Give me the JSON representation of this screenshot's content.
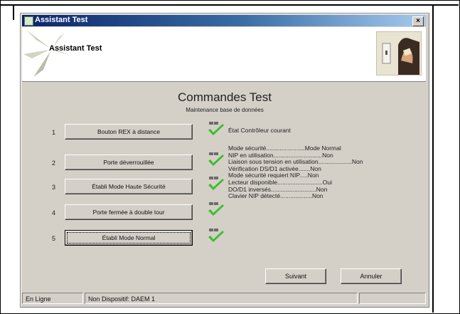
{
  "window": {
    "title": "Assistant Test",
    "close_glyph": "×"
  },
  "header": {
    "title": "Assistant Test"
  },
  "main": {
    "title": "Commandes Test",
    "subtitle": "Maintenance base de données"
  },
  "commands": [
    {
      "number": "1",
      "label": "Bouton REX à distance"
    },
    {
      "number": "2",
      "label": "Porte déverrouillée"
    },
    {
      "number": "3",
      "label": "Établi Mode Haute Sécurité"
    },
    {
      "number": "4",
      "label": "Porte fermée à double tour"
    },
    {
      "number": "5",
      "label": "Établi Mode Normal"
    }
  ],
  "info": {
    "line1": "État Contrôleur courant",
    "block": "Mode sécurité.......................Mode Normal\nNIP en utilisation.............................Non\nLiaison sous tension en utilisation....................Non\nVérification DS/D1 activée.......Non\nMode sécurité requiert NIP.....Non\nLecteur disponible...........................Oui\nDO/D1 inversés...........................Non\nClavier NIP détecté...................Non"
  },
  "footer": {
    "next_label": "Suivant",
    "cancel_label": "Annuler"
  },
  "status": {
    "mode": "En Ligne",
    "device": "Non Dispositif: DAEM 1"
  },
  "colors": {
    "title_bar": "#0a246a",
    "dialog_bg": "#d4d0c8",
    "check_green": "#3bbf2c"
  }
}
